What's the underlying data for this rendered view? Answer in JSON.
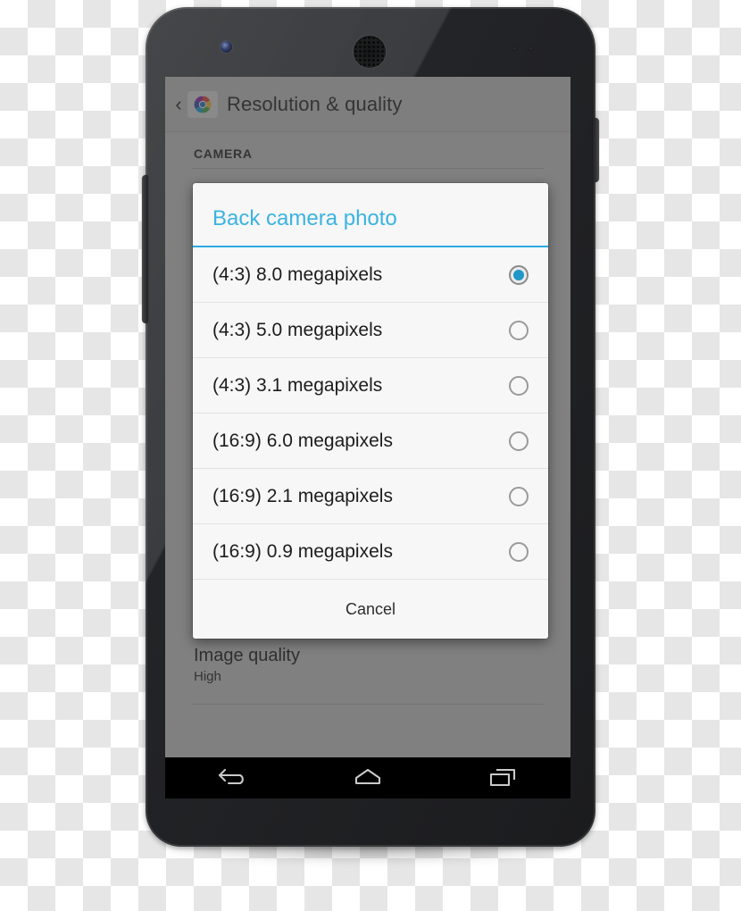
{
  "device": {
    "name": "android-smartphone",
    "hardware": {
      "front_camera": "front-camera-lens",
      "earpiece": "earpiece-speaker-grille",
      "sensors": "proximity-light-sensors",
      "volume_button": "volume-rocker",
      "power_button": "power-button"
    }
  },
  "app": {
    "action_bar": {
      "back_chevron": "‹",
      "icon": "camera-app-icon",
      "title": "Resolution & quality"
    },
    "sections": [
      {
        "header": "CAMERA"
      }
    ],
    "preferences": [
      {
        "title": "Image quality",
        "summary": "High"
      }
    ]
  },
  "dialog": {
    "title": "Back camera photo",
    "title_color": "#3ab3e2",
    "accent_color": "#2aabe2",
    "selected_index": 0,
    "options": [
      {
        "label": "(4:3) 8.0 megapixels",
        "selected": true
      },
      {
        "label": "(4:3) 5.0 megapixels",
        "selected": false
      },
      {
        "label": "(4:3) 3.1 megapixels",
        "selected": false
      },
      {
        "label": "(16:9) 6.0 megapixels",
        "selected": false
      },
      {
        "label": "(16:9) 2.1 megapixels",
        "selected": false
      },
      {
        "label": "(16:9) 0.9 megapixels",
        "selected": false
      }
    ],
    "cancel_label": "Cancel"
  },
  "navbar": {
    "buttons": [
      {
        "name": "back-icon",
        "label": "Back"
      },
      {
        "name": "home-icon",
        "label": "Home"
      },
      {
        "name": "recents-icon",
        "label": "Recent apps"
      }
    ]
  }
}
